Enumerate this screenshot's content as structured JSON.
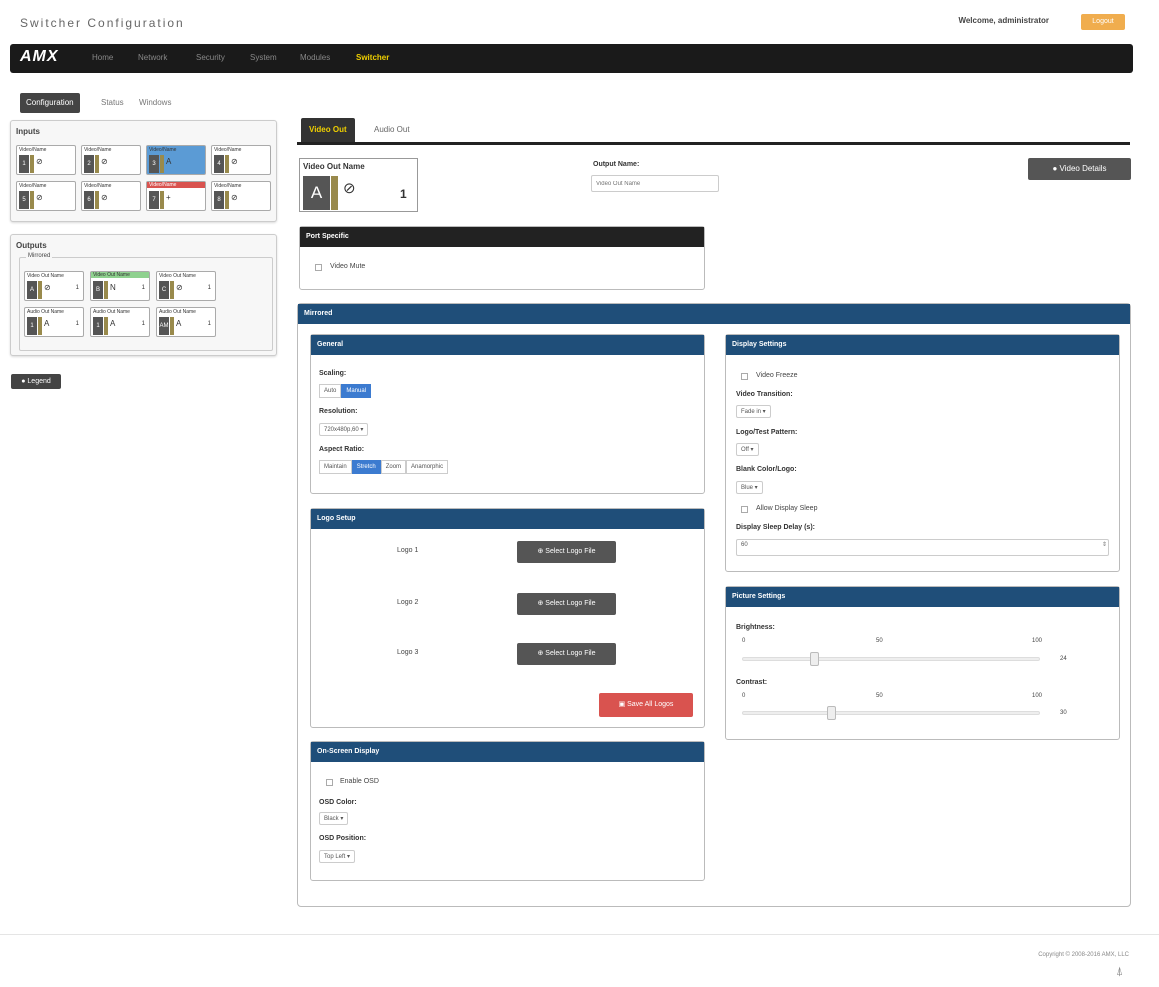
{
  "app": {
    "title": "Switcher Configuration",
    "welcome": "Welcome, administrator",
    "logout": "Logout"
  },
  "nav": {
    "brand": "AMX",
    "items": [
      "Home",
      "Network",
      "Security",
      "System",
      "Modules",
      "Switcher"
    ],
    "active": "Switcher"
  },
  "subtabs": [
    "Configuration",
    "Status",
    "Windows"
  ],
  "inputs": {
    "title": "Inputs",
    "cards": [
      {
        "label": "Video/Name",
        "id": "1",
        "glyph": "⊘"
      },
      {
        "label": "Video/Name",
        "id": "2",
        "glyph": "⊘"
      },
      {
        "label": "Video/Name",
        "id": "3",
        "glyph": "A"
      },
      {
        "label": "Video/Name",
        "id": "4",
        "glyph": "⊘"
      },
      {
        "label": "Video/Name",
        "id": "5",
        "glyph": "⊘"
      },
      {
        "label": "Video/Name",
        "id": "6",
        "glyph": "⊘"
      },
      {
        "label": "Video/Name",
        "id": "7",
        "glyph": "+"
      },
      {
        "label": "Video/Name",
        "id": "8",
        "glyph": "⊘"
      }
    ]
  },
  "outputs": {
    "title": "Outputs",
    "group": "Mirrored",
    "cards": [
      {
        "label": "Video Out Name",
        "id": "A",
        "glyph": "⊘",
        "num": "1"
      },
      {
        "label": "Video Out Name",
        "id": "B",
        "glyph": "N",
        "num": "1"
      },
      {
        "label": "Video Out Name",
        "id": "C",
        "glyph": "⊘",
        "num": "1"
      },
      {
        "label": "Audio Out Name",
        "id": "1",
        "glyph": "A",
        "num": "1"
      },
      {
        "label": "Audio Out Name",
        "id": "1",
        "glyph": "A",
        "num": "1"
      },
      {
        "label": "Audio Out Name",
        "id": "AM",
        "glyph": "A",
        "num": "1"
      }
    ]
  },
  "legend": "Legend",
  "tabs": {
    "video_out": "Video Out",
    "audio_out": "Audio Out"
  },
  "video_out_card": {
    "title": "Video Out Name",
    "letter": "A",
    "glyph": "⊘",
    "num": "1"
  },
  "output_name": {
    "label": "Output Name:",
    "placeholder": "Video Out Name"
  },
  "video_details": "Video Details",
  "port_specific": {
    "title": "Port Specific",
    "video_mute": "Video Mute"
  },
  "mirrored": "Mirrored",
  "general": {
    "title": "General",
    "scaling_label": "Scaling:",
    "scaling_opts": [
      "Auto",
      "Manual"
    ],
    "resolution_label": "Resolution:",
    "resolution": "720x480p,60 ▾",
    "aspect_label": "Aspect Ratio:",
    "aspect_opts": [
      "Maintain",
      "Stretch",
      "Zoom",
      "Anamorphic"
    ]
  },
  "logo_setup": {
    "title": "Logo Setup",
    "logos": [
      "Logo 1",
      "Logo 2",
      "Logo 3"
    ],
    "select": "Select Logo File",
    "save": "Save All Logos"
  },
  "osd": {
    "title": "On-Screen Display",
    "enable": "Enable OSD",
    "color_label": "OSD Color:",
    "color": "Black ▾",
    "position_label": "OSD Position:",
    "position": "Top Left ▾"
  },
  "display": {
    "title": "Display Settings",
    "freeze": "Video Freeze",
    "transition_label": "Video Transition:",
    "transition": "Fade in ▾",
    "logo_label": "Logo/Test Pattern:",
    "logo": "Off ▾",
    "blank_label": "Blank Color/Logo:",
    "blank": "Blue ▾",
    "allow_sleep": "Allow Display Sleep",
    "sleep_delay_label": "Display Sleep Delay (s):",
    "sleep_delay": "60"
  },
  "picture": {
    "title": "Picture Settings",
    "brightness_label": "Brightness:",
    "brightness_ticks": [
      "0",
      "50",
      "100"
    ],
    "brightness": "24",
    "contrast_label": "Contrast:",
    "contrast_ticks": [
      "0",
      "50",
      "100"
    ],
    "contrast": "30"
  },
  "footer": "Copyright © 2008-2016 AMX, LLC",
  "colors": {
    "nav_bg": "#1a1a1a",
    "active_nav": "#f0d000",
    "panel_head": "#1f4e79",
    "save": "#d9534f"
  }
}
